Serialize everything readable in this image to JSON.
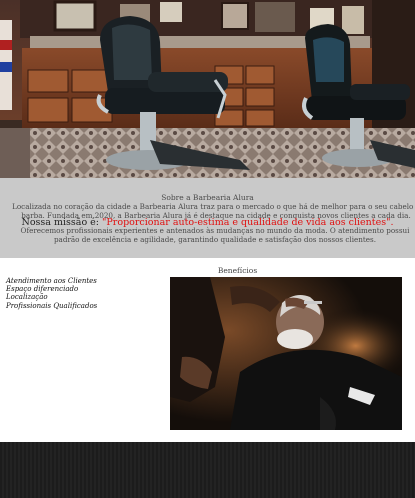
{
  "hero": {
    "image_label": "barbershop-interior-photo"
  },
  "about": {
    "title": "Sobre a Barbearia Alura",
    "paragraph1": "Localizada no coração da cidade a Barbearia Alura traz para o mercado o que há de melhor para o seu cabelo e barba. Fundada em 2020, a Barbearia Alura já é destaque na cidade e conquista novos clientes a cada dia.",
    "mission_label": "Nossa missão é:",
    "mission_quote": "\"Proporcionar auto-estima e qualidade de vida aos clientes\".",
    "paragraph2": "Oferecemos profissionais experientes e antenados às mudanças no mundo da moda. O atendimento possui padrão de excelência e agilidade, garantindo qualidade e satisfação dos nossos clientes."
  },
  "benefits": {
    "title": "Benefícios",
    "items": [
      "Atendimento aos Clientes",
      "Espaço diferenciado",
      "Localização",
      "Profissionais Qualificados"
    ]
  },
  "colors": {
    "about_bg": "#c9c9c9",
    "mission_accent": "#e01010",
    "footer_bg": "#1f1f1f"
  }
}
